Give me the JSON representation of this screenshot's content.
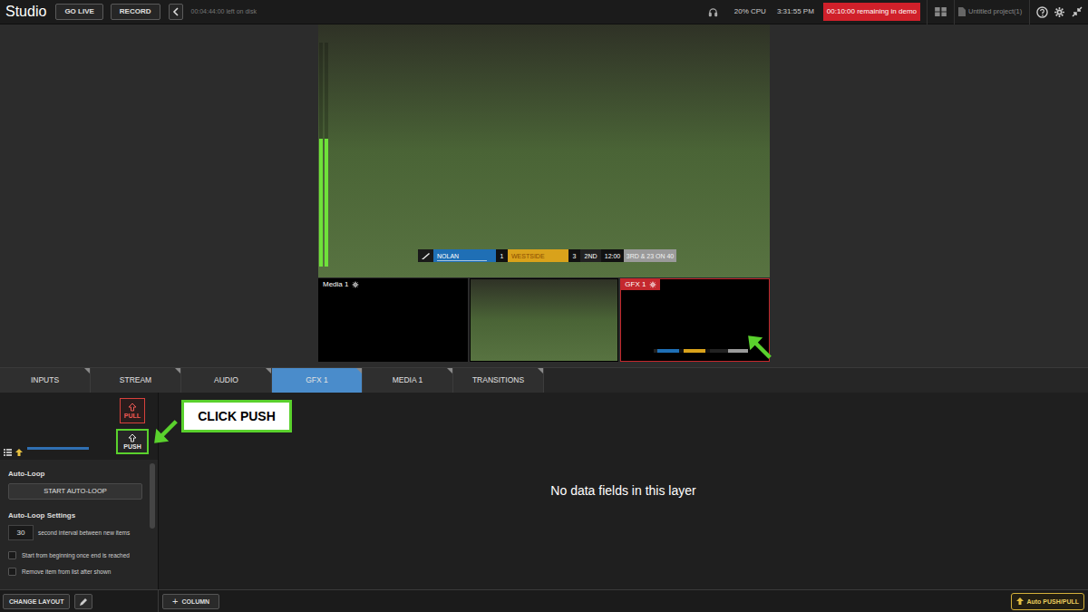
{
  "top_bar": {
    "logo": "Studio",
    "buttons": [
      {
        "label": "GO LIVE"
      },
      {
        "label": "RECORD"
      }
    ],
    "disk_status": "00:04:44:00 left on disk",
    "cpu": "20% CPU",
    "clock": "3:31:55 PM",
    "demo_badge": "00:10:00 remaining in demo",
    "project": "Untitled project(1)"
  },
  "program": {
    "audio_meter": [
      {
        "level": 0.57
      },
      {
        "level": 0.57
      }
    ],
    "scoreboard": {
      "home_team": "NOLAN",
      "home_score": "1",
      "away_team": "WESTSIDE",
      "away_score": "3",
      "period": "2ND",
      "clock": "12:00",
      "down": "3RD & 23 ON 40"
    }
  },
  "sources": [
    {
      "kind": "media",
      "label": "Media 1",
      "selected": false
    },
    {
      "kind": "video",
      "selected": false
    },
    {
      "kind": "gfx",
      "label": "GFX 1",
      "selected": true
    }
  ],
  "tabs": [
    {
      "label": "INPUTS",
      "selected": false
    },
    {
      "label": "STREAM",
      "selected": false
    },
    {
      "label": "AUDIO",
      "selected": false
    },
    {
      "label": "GFX 1",
      "selected": true
    },
    {
      "label": "MEDIA 1",
      "selected": false
    },
    {
      "label": "TRANSITIONS",
      "selected": false
    }
  ],
  "layer_panel": {
    "pull": "PULL",
    "push": "PUSH",
    "auto_loop_title": "Auto-Loop",
    "start_button": "START AUTO-LOOP",
    "settings_title": "Auto-Loop Settings",
    "interval": "30",
    "interval_label": "second interval between new items",
    "options": [
      {
        "label": "Start from beginning once end is reached",
        "checked": false
      },
      {
        "label": "Remove item from list after shown",
        "checked": false
      }
    ]
  },
  "annotation": {
    "callout": "CLICK PUSH"
  },
  "empty_message": "No data fields in this layer",
  "bottom_bar": {
    "change_layout": "CHANGE LAYOUT",
    "add_column_icon": "+",
    "add_column": "COLUMN",
    "auto_push_pull": "Auto PUSH/PULL"
  }
}
